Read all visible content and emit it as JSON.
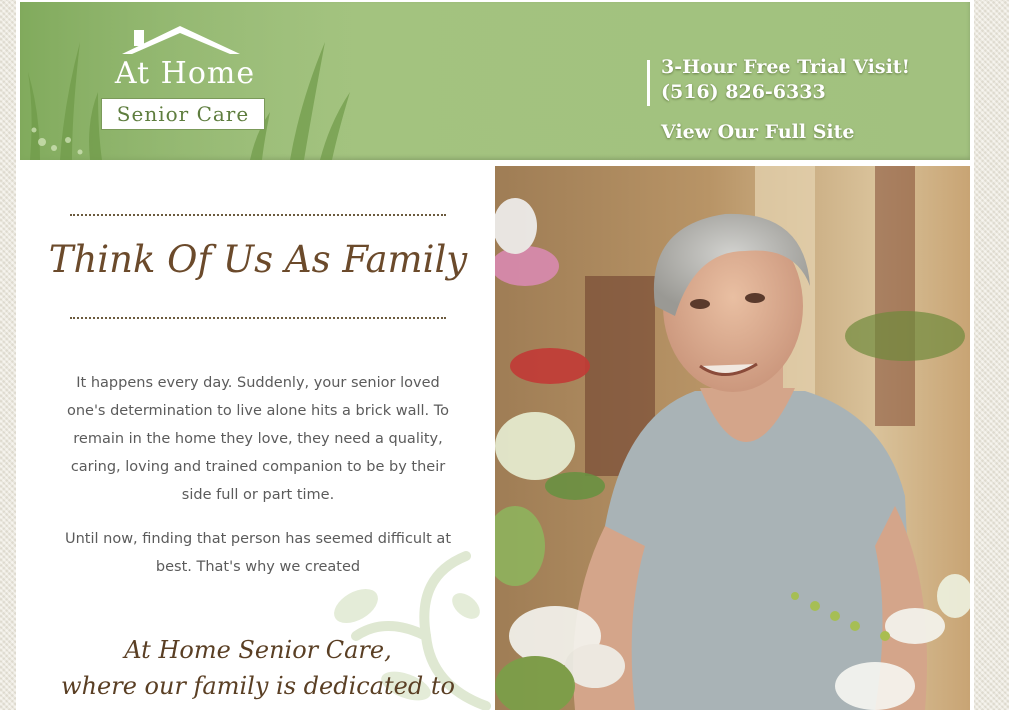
{
  "header": {
    "logo_title": "At Home",
    "logo_subtitle": "Senior Care",
    "cta_line1": "3-Hour Free Trial Visit!",
    "cta_line2": "(516) 826-6333",
    "cta_link": "View Our Full Site"
  },
  "main": {
    "headline": "Think Of Us As Family",
    "paragraph1": "It happens every day. Suddenly, your senior loved one's determination to live alone hits a brick wall. To remain in the home they love, they need a quality, caring, loving and trained companion to be by their side full or part time.",
    "paragraph2": "Until now, finding that person has seemed difficult at best. That's why we created",
    "tagline_line1": "At Home Senior Care,",
    "tagline_line2": "where our family is dedicated to"
  },
  "colors": {
    "header_green": "#a2c17f",
    "headline_brown": "#6b4a2b",
    "body_text": "#5b5b5b",
    "page_bg": "#ece8dc"
  },
  "icons": {
    "logo_roof": "house-roof-icon",
    "decoration": "floral-swirl-decoration"
  }
}
